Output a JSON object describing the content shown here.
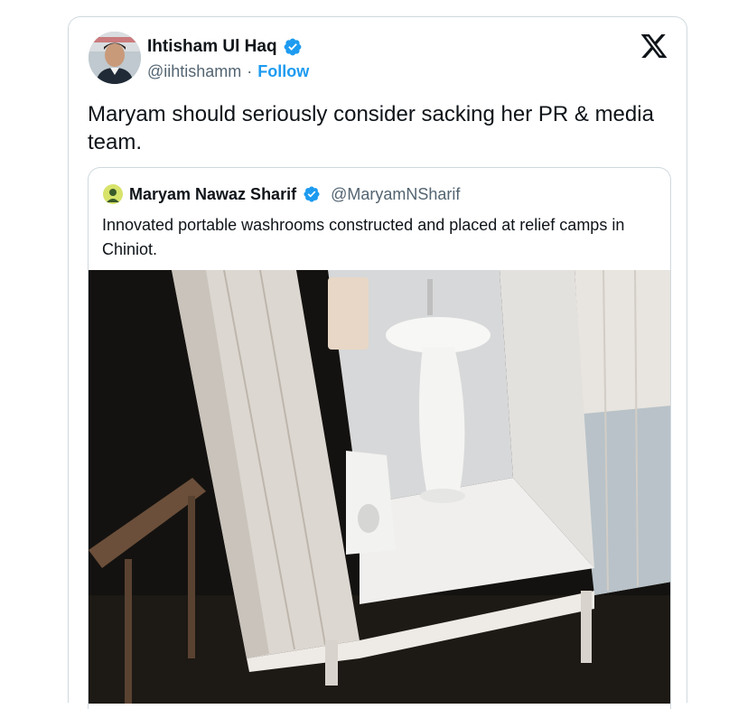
{
  "tweet": {
    "author_name": "Ihtisham Ul Haq",
    "author_handle": "@iihtishamm",
    "separator": "·",
    "follow_label": "Follow",
    "text": "Maryam should seriously consider sacking her PR & media team."
  },
  "quoted": {
    "author_name": "Maryam Nawaz Sharif",
    "author_handle": "@MaryamNSharif",
    "text": "Innovated portable washrooms constructed and placed at relief camps in Chiniot."
  },
  "icons": {
    "verified": "verified-badge-icon",
    "platform": "x-logo-icon"
  },
  "colors": {
    "accent": "#1d9bf0",
    "text": "#0f1419",
    "secondary": "#536471",
    "border": "#cfd9de"
  }
}
